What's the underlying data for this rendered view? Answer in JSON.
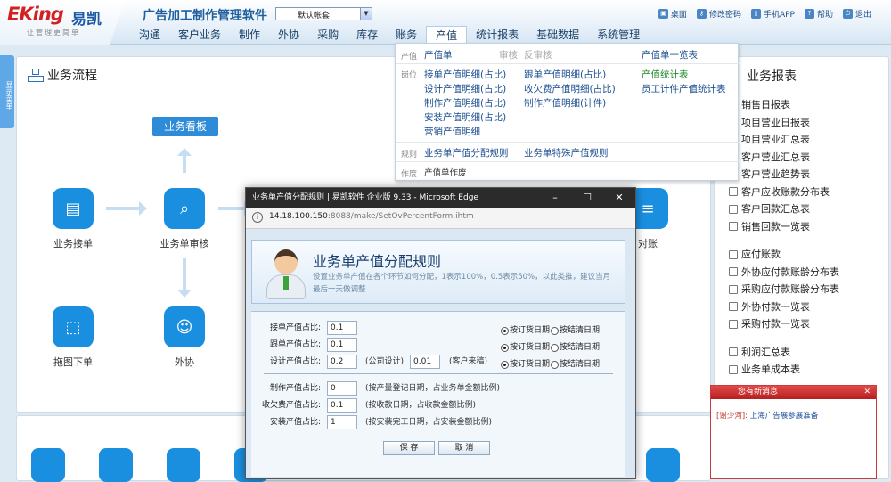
{
  "app": {
    "logo_en": "EKing",
    "logo_cn": "易凯",
    "slogan": "让管理更简单",
    "title": "广告加工制作管理软件",
    "account_select": "默认帐套"
  },
  "toplinks": [
    {
      "label": "桌面",
      "icon": "desktop-icon"
    },
    {
      "label": "修改密码",
      "icon": "key-icon"
    },
    {
      "label": "手机APP",
      "icon": "phone-icon"
    },
    {
      "label": "帮助",
      "icon": "help-icon"
    },
    {
      "label": "退出",
      "icon": "power-icon"
    }
  ],
  "nav": [
    "沟通",
    "客户业务",
    "制作",
    "外协",
    "采购",
    "库存",
    "账务",
    "产值",
    "统计报表",
    "基础数据",
    "系统管理"
  ],
  "nav_active": "产值",
  "left_tab": "显示菜单",
  "flow": {
    "title": "业务流程",
    "board_button": "业务看板",
    "nodes": [
      "业务接单",
      "业务单审核",
      "拖图下单",
      "外协"
    ],
    "partial_label": "对账"
  },
  "reports": {
    "title": "业务报表",
    "group1": [
      "销售日报表",
      "项目营业日报表",
      "项目营业汇总表",
      "客户营业汇总表",
      "客户营业趋势表",
      "客户应收账款分布表",
      "客户回款汇总表",
      "销售回款一览表"
    ],
    "group2": [
      "应付账款",
      "外协应付款账龄分布表",
      "采购应付款账龄分布表",
      "外协付款一览表",
      "采购付款一览表"
    ],
    "group3": [
      "利润汇总表",
      "业务单成本表"
    ]
  },
  "dropdown": {
    "row1": {
      "cat": "产值",
      "items": [
        "产值单",
        "审核",
        "反审核"
      ],
      "right": "产值单一览表"
    },
    "row2": {
      "cat": "岗位",
      "col1": [
        "接单产值明细(占比)",
        "设计产值明细(占比)",
        "制作产值明细(占比)",
        "安装产值明细(占比)",
        "营销产值明细"
      ],
      "col2": [
        "跟单产值明细(占比)",
        "收欠费产值明细(占比)",
        "制作产值明细(计件)"
      ],
      "col3": [
        "产值统计表",
        "员工计件产值统计表"
      ]
    },
    "row3": {
      "cat": "规则",
      "items": [
        "业务单产值分配规则",
        "业务单特殊产值规则"
      ]
    },
    "row4": {
      "cat": "作废",
      "items": [
        "产值单作废"
      ]
    }
  },
  "dialog": {
    "window_title": "业务单产值分配规则 | 易凯软件 企业版 9.33 - Microsoft Edge",
    "url_host": "14.18.100.150",
    "url_rest": ":8088/make/SetOvPercentForm.ihtm",
    "heading": "业务单产值分配规则",
    "description": "设置业务单产值在各个环节如何分配，1表示100%，0.5表示50%，以此类推，建议当月最后一天做调整",
    "fields": [
      {
        "label": "接单产值占比:",
        "value": "0.1"
      },
      {
        "label": "跟单产值占比:",
        "value": "0.1"
      },
      {
        "label": "设计产值占比:",
        "value": "0.2",
        "note1": "(公司设计)",
        "value2": "0.01",
        "note2": "(客户来稿)"
      },
      {
        "label": "制作产值占比:",
        "value": "0",
        "note": "(按产量登记日期，占业务单金额比例)"
      },
      {
        "label": "收欠费产值占比:",
        "value": "0.1",
        "note": "(按收款日期，占收款金额比例)"
      },
      {
        "label": "安装产值占比:",
        "value": "1",
        "note": "(按安装完工日期，占安装金额比例)"
      }
    ],
    "radio_a": "按订货日期",
    "radio_b": "按结清日期",
    "save": "保 存",
    "cancel": "取 消"
  },
  "toast": {
    "title": "您有新消息",
    "sender": "[谢少河]:",
    "message": "上海广告展参展准备"
  }
}
